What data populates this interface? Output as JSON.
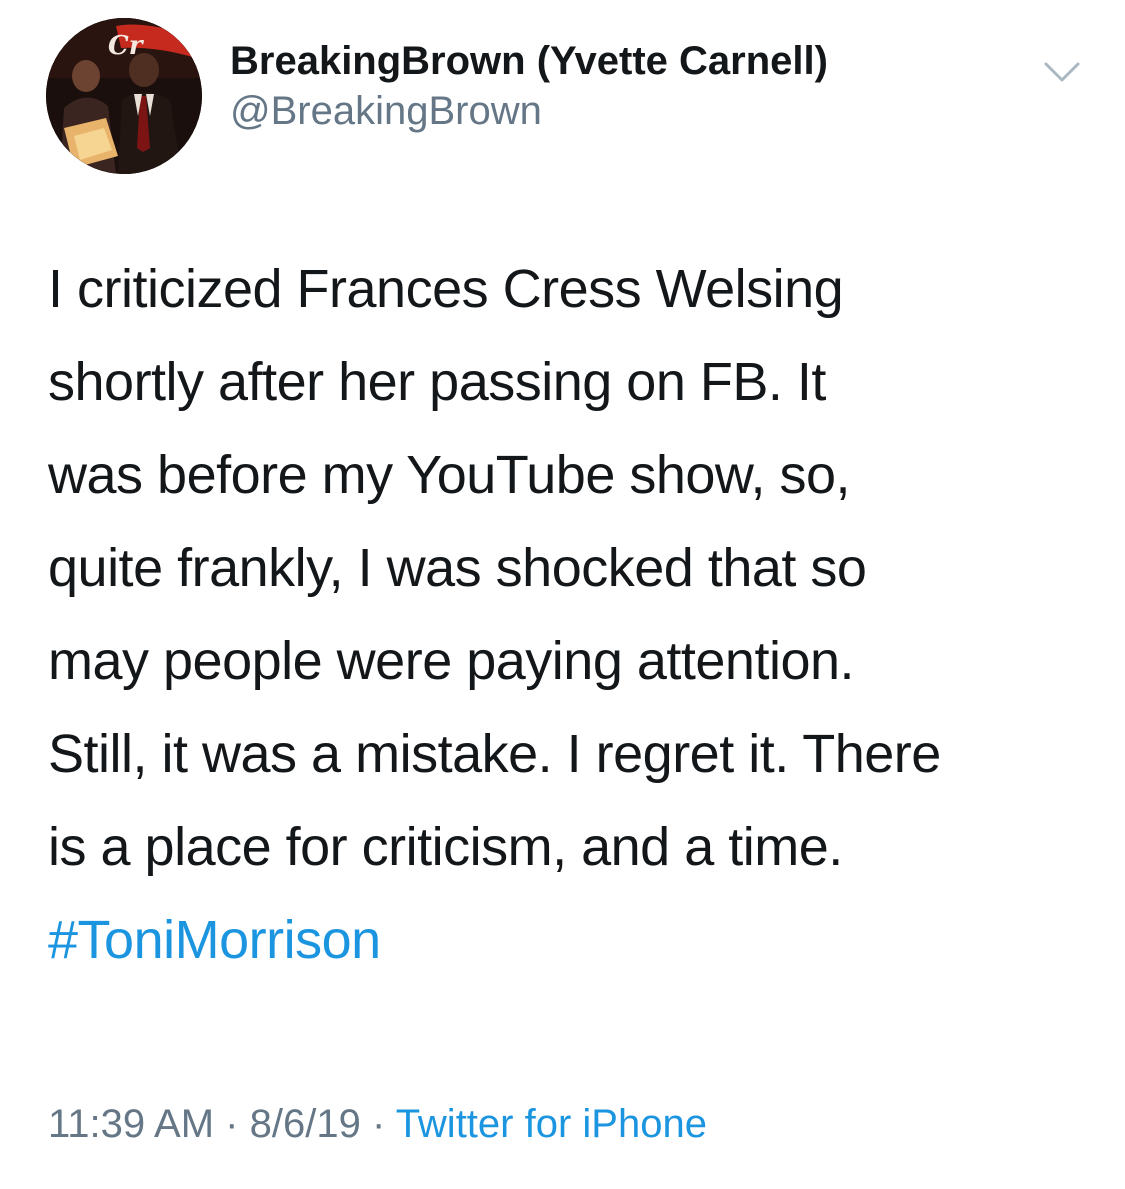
{
  "tweet": {
    "author": {
      "display_name": "BreakingBrown (Yvette Carnell)",
      "handle": "@BreakingBrown",
      "avatar_icon": "profile-photo"
    },
    "menu_icon": "chevron-down-icon",
    "body_lines": [
      "I criticized Frances Cress Welsing",
      "shortly after her passing on FB. It",
      "was before my YouTube show, so,",
      "quite frankly, I was shocked that so",
      "may people were paying attention.",
      "Still, it was a mistake. I regret it. There",
      "is a place for criticism, and a time."
    ],
    "hashtag": "#ToniMorrison",
    "time": "11:39 AM",
    "separator": "·",
    "date": "8/6/19",
    "source": "Twitter for iPhone"
  },
  "colors": {
    "text": "#14171a",
    "secondary": "#657786",
    "link": "#1b95e0",
    "background": "#ffffff"
  }
}
